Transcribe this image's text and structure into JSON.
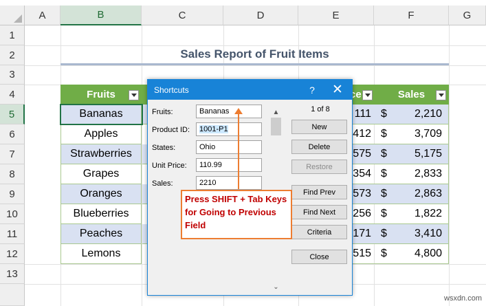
{
  "columns": [
    "A",
    "B",
    "C",
    "D",
    "E",
    "F",
    "G"
  ],
  "rows": [
    "1",
    "2",
    "3",
    "4",
    "5",
    "6",
    "7",
    "8",
    "9",
    "10",
    "11",
    "12",
    "13"
  ],
  "selected_column": "B",
  "selected_row": "5",
  "report_title": "Sales Report of Fruit Items",
  "table": {
    "header_fruits": "Fruits",
    "header_price_partial": "ce",
    "header_sales": "Sales",
    "fruits": [
      "Bananas",
      "Apples",
      "Strawberries",
      "Grapes",
      "Oranges",
      "Blueberries",
      "Peaches",
      "Lemons"
    ],
    "price_partial": [
      "111",
      "412",
      "575",
      "354",
      "573",
      "256",
      "171",
      "515"
    ],
    "currency": "$",
    "sales": [
      "2,210",
      "3,709",
      "5,175",
      "2,833",
      "2,863",
      "1,822",
      "3,410",
      "4,800"
    ]
  },
  "dialog": {
    "title": "Shortcuts",
    "help": "?",
    "close": "✕",
    "record_position": "1 of 8",
    "fields": [
      {
        "label": "Fruits:",
        "value": "Bananas"
      },
      {
        "label": "Product ID:",
        "value": "1001-P1"
      },
      {
        "label": "States:",
        "value": "Ohio"
      },
      {
        "label": "Unit Price:",
        "value": "110.99"
      },
      {
        "label": "Sales:",
        "value": "2210"
      }
    ],
    "buttons": {
      "new": "New",
      "delete": "Delete",
      "restore": "Restore",
      "find_prev": "Find Prev",
      "find_next": "Find Next",
      "criteria": "Criteria",
      "close": "Close"
    }
  },
  "annotation": {
    "text_1": "Press ",
    "key_1": "SHIFT",
    "text_2": " + Tab Keys for Going to Previous Field"
  },
  "watermark": "wsxdn.com",
  "colors": {
    "accent_green": "#70ad47",
    "band_blue": "#d9e1f2",
    "dialog_blue": "#1883d7",
    "annotation_orange": "#ed7d31",
    "annotation_red": "#c00000"
  }
}
